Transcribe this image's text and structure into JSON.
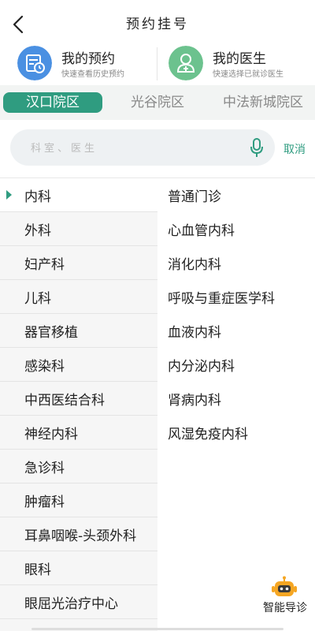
{
  "header": {
    "title": "预约挂号",
    "back_icon": "chevron-left-icon"
  },
  "quick_cards": [
    {
      "title": "我的预约",
      "subtitle": "快速查看历史预约",
      "icon": "calendar-clock-icon",
      "color": "#4a90e2"
    },
    {
      "title": "我的医生",
      "subtitle": "快速选择已就诊医生",
      "icon": "doctor-icon",
      "color": "#6cc28e"
    }
  ],
  "campus_tabs": [
    {
      "label": "汉口院区",
      "active": true
    },
    {
      "label": "光谷院区",
      "active": false
    },
    {
      "label": "中法新城院区",
      "active": false
    }
  ],
  "search": {
    "placeholder": "科室、医生",
    "value": "",
    "cancel_label": "取消",
    "mic_icon": "microphone-icon"
  },
  "departments": [
    {
      "label": "内科",
      "active": true
    },
    {
      "label": "外科"
    },
    {
      "label": "妇产科"
    },
    {
      "label": "儿科"
    },
    {
      "label": "器官移植"
    },
    {
      "label": "感染科"
    },
    {
      "label": "中西医结合科"
    },
    {
      "label": "神经内科"
    },
    {
      "label": "急诊科"
    },
    {
      "label": "肿瘤科"
    },
    {
      "label": "耳鼻咽喉-头颈外科"
    },
    {
      "label": "眼科"
    },
    {
      "label": "眼屈光治疗中心"
    }
  ],
  "sub_departments": [
    "普通门诊",
    "心血管内科",
    "消化内科",
    "呼吸与重症医学科",
    "血液内科",
    "内分泌内科",
    "肾病内科",
    "风湿免疫内科"
  ],
  "smart_guide": {
    "label": "智能导诊",
    "icon": "robot-icon"
  },
  "colors": {
    "accent": "#2f9c80",
    "card_blue": "#4a90e2",
    "card_green": "#6cc28e",
    "robot": "#f5a623"
  }
}
